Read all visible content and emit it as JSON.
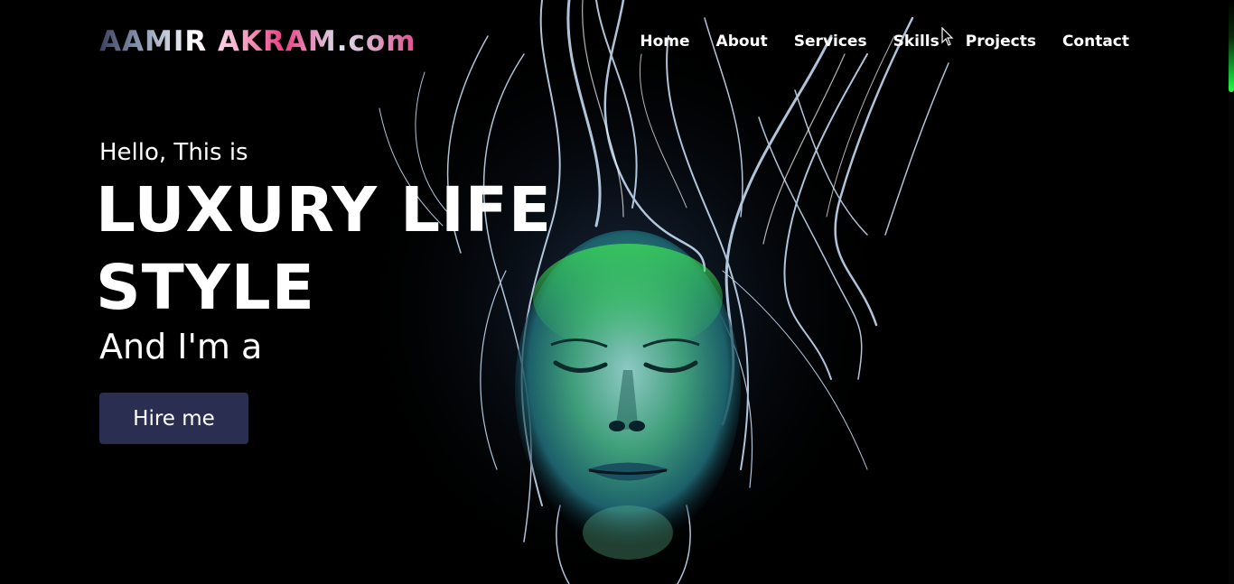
{
  "brand": {
    "logo_text": "AAMIR AKRAM.com"
  },
  "nav": {
    "items": [
      "Home",
      "About",
      "Services",
      "Skills",
      "Projects",
      "Contact"
    ]
  },
  "hero": {
    "greeting": "Hello, This is",
    "headline_line1": "LUXURY LIFE",
    "headline_line2": "STYLE",
    "subline": "And I'm a",
    "cta_label": "Hire me",
    "background_image": "glowing-face-light-trails"
  },
  "colors": {
    "background": "#000000",
    "button_bg": "#2a2f52",
    "text": "#ffffff",
    "logo_accent": "#ec3f86",
    "scroll_thumb": "#27ff45"
  }
}
